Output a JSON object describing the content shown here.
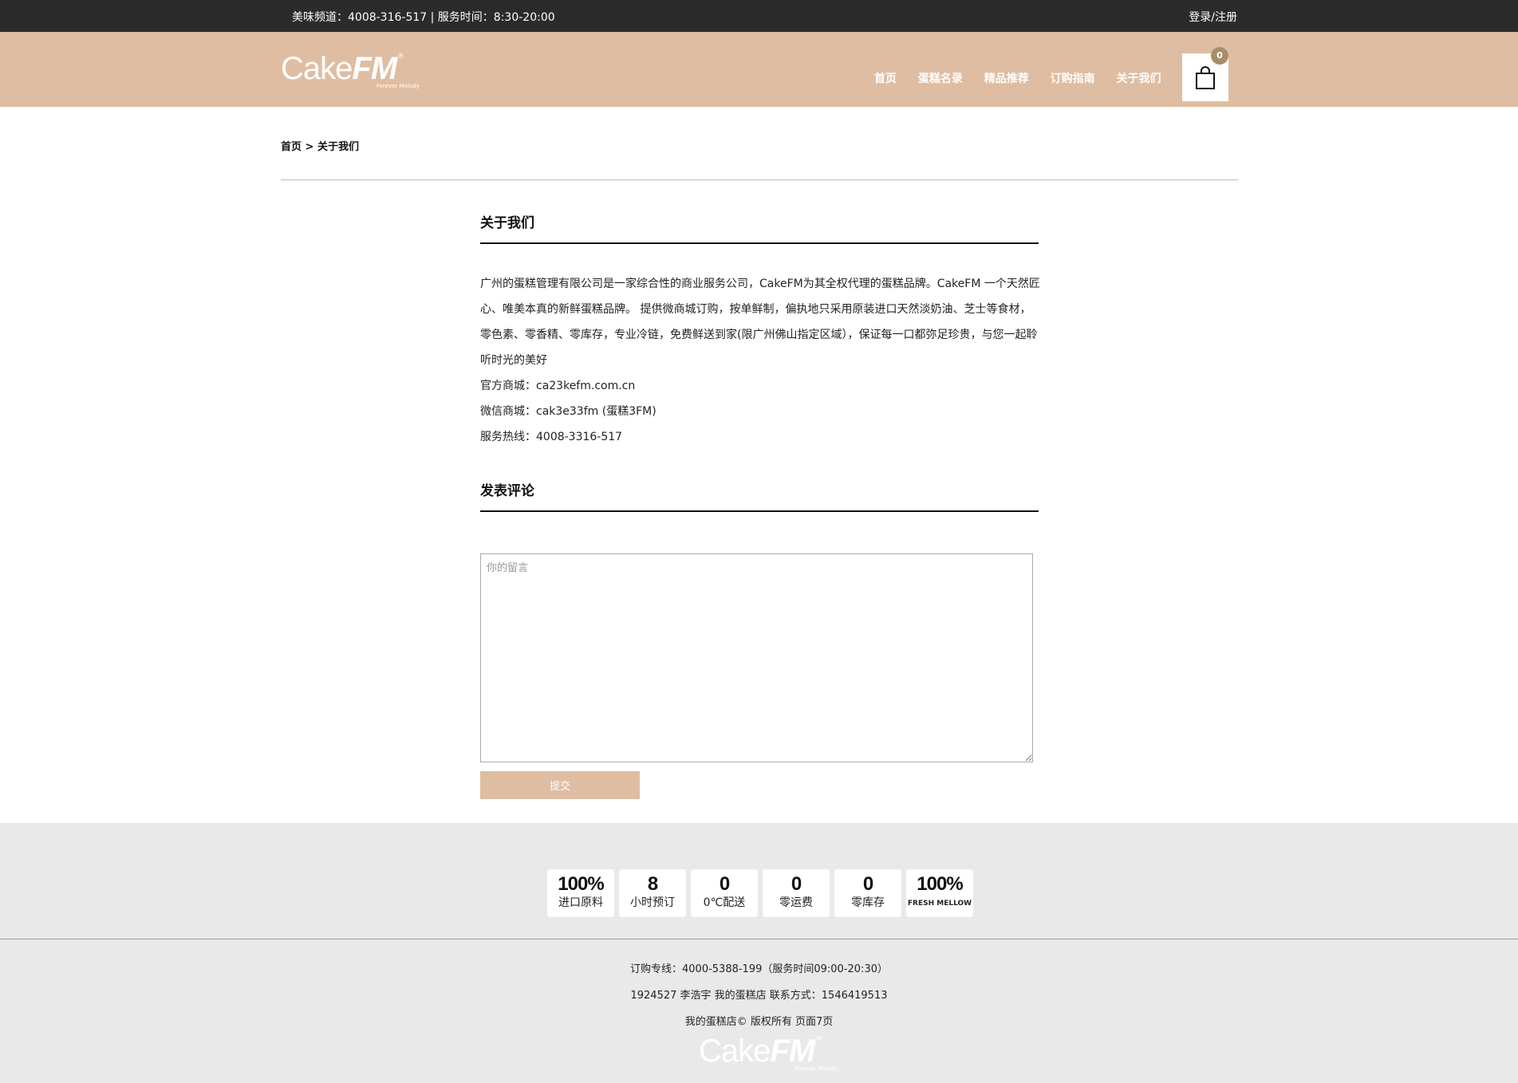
{
  "topbar": {
    "hotline": "美味频道：4008-316-517 | 服务时间：8:30-20:00",
    "login": "登录/注册"
  },
  "header": {
    "logo": {
      "cake": "Cake",
      "fm": "FM",
      "reg": "®",
      "tagline": "Forever Melody"
    },
    "nav": [
      "首页",
      "蛋糕名录",
      "精品推荐",
      "订购指南",
      "关于我们"
    ],
    "cart_count": "0"
  },
  "breadcrumb": {
    "home": "首页",
    "separator": " > ",
    "current": "关于我们"
  },
  "about": {
    "title": "关于我们",
    "paragraph": "广州的蛋糕管理有限公司是一家综合性的商业服务公司，CakeFM为其全权代理的蛋糕品牌。CakeFM 一个天然匠心、唯美本真的新鲜蛋糕品牌。 提供微商城订购，按单鲜制，偏执地只采用原装进口天然淡奶油、芝士等食材，零色素、零香精、零库存，专业冷链，免费鲜送到家(限广州佛山指定区域），保证每一口都弥足珍贵，与您一起聆听时光的美好",
    "mall": "官方商城：ca23kefm.com.cn",
    "wechat": "微信商城：cak3e33fm (蛋糕3FM)",
    "service": "服务热线：4008-3316-517"
  },
  "comment": {
    "title": "发表评论",
    "placeholder": "你的留言",
    "submit_label": "提交"
  },
  "stats": [
    {
      "num": "100%",
      "label": "进口原料"
    },
    {
      "num": "8",
      "label": "小时预订"
    },
    {
      "num": "0",
      "label": "0℃配送"
    },
    {
      "num": "0",
      "label": "零运费"
    },
    {
      "num": "0",
      "label": "零库存"
    },
    {
      "num": "100%",
      "label": "FRESH MELLOW"
    }
  ],
  "footer": {
    "order_line": "订购专线：4000-5388-199（服务时间09:00-20:30）",
    "contact": "1924527 李浩宇 我的蛋糕店 联系方式：1546419513",
    "copyright": "我的蛋糕店© 版权所有 页面7页"
  },
  "colors": {
    "topbar": "#2b2b2b",
    "header": "#dfbda2",
    "badge": "#a98c6a",
    "footer": "#e9e9e9"
  }
}
